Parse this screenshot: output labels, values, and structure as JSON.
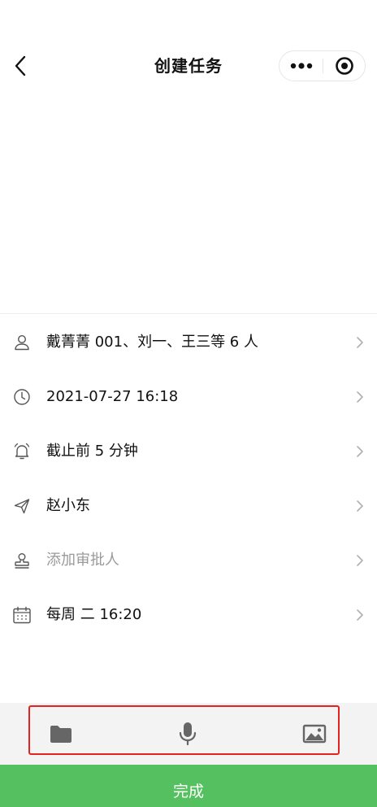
{
  "header": {
    "title": "创建任务",
    "back_icon": "chevron-left-icon",
    "more_icon": "more-dots-icon",
    "close_icon": "target-close-icon"
  },
  "rows": [
    {
      "icon": "person-icon",
      "label": "戴菁菁 001、刘一、王三等 6 人",
      "placeholder": false
    },
    {
      "icon": "clock-icon",
      "label": "2021-07-27 16:18",
      "placeholder": false
    },
    {
      "icon": "bell-icon",
      "label": "截止前 5 分钟",
      "placeholder": false
    },
    {
      "icon": "send-icon",
      "label": "赵小东",
      "placeholder": false
    },
    {
      "icon": "approver-stamp-icon",
      "label": "添加审批人",
      "placeholder": true
    },
    {
      "icon": "calendar-icon",
      "label": "每周 二 16:20",
      "placeholder": false
    }
  ],
  "toolbar": {
    "items": [
      "folder-icon",
      "microphone-icon",
      "image-icon"
    ],
    "highlight_color": "#e32222"
  },
  "footer": {
    "done_label": "完成",
    "done_color": "#55c05f"
  }
}
